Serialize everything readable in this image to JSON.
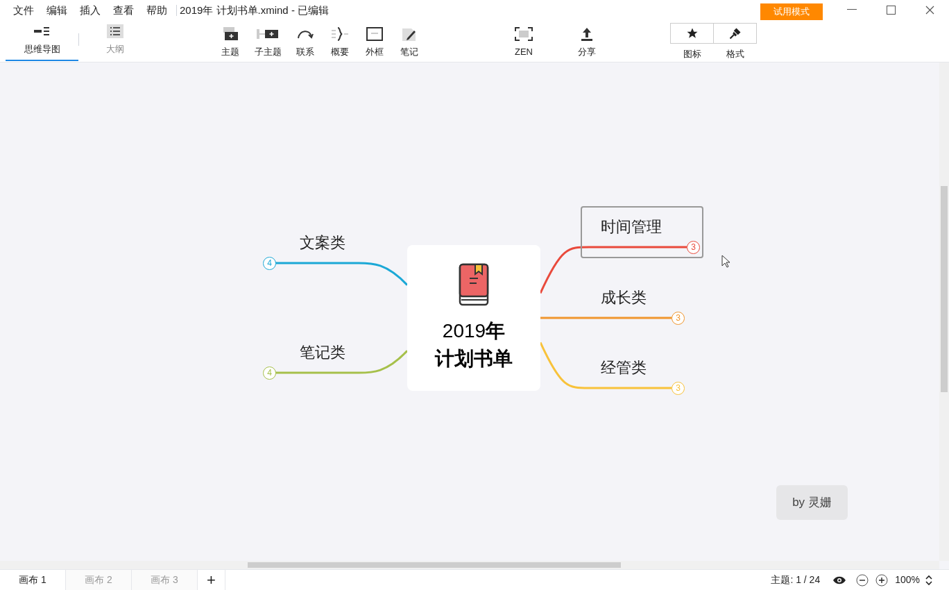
{
  "menu": [
    "文件",
    "编辑",
    "插入",
    "查看",
    "帮助"
  ],
  "window": {
    "title": "2019年 计划书单.xmind - 已编辑",
    "trial_button": "试用模式"
  },
  "view_tabs": [
    {
      "label": "思维导图",
      "selected": true
    },
    {
      "label": "大纲",
      "selected": false
    }
  ],
  "insert_tools": [
    "主题",
    "子主题",
    "联系",
    "概要",
    "外框",
    "笔记"
  ],
  "extra_tools": [
    "ZEN",
    "分享"
  ],
  "panel_tools": [
    "图标",
    "格式"
  ],
  "central_topic": {
    "title_lines": [
      "2019**年**",
      "计划书单"
    ]
  },
  "right_branches": [
    {
      "label": "时间管理",
      "count": "3",
      "color": "#e94a3c",
      "selected": true
    },
    {
      "label": "成长类",
      "count": "3",
      "color": "#f0962e",
      "selected": false
    },
    {
      "label": "经管类",
      "count": "3",
      "color": "#f8c23a",
      "selected": false
    }
  ],
  "left_branches": [
    {
      "label": "文案类",
      "count": "4",
      "color": "#1ba8d6",
      "selected": false
    },
    {
      "label": "笔记类",
      "count": "4",
      "color": "#a6c04a",
      "selected": false
    }
  ],
  "signature": "by 灵姗",
  "sheets": [
    {
      "label": "画布 1",
      "selected": true
    },
    {
      "label": "画布 2",
      "selected": false
    },
    {
      "label": "画布 3",
      "selected": false
    }
  ],
  "add_sheet": "+",
  "status": {
    "topic_count": "主题: 1 / 24",
    "zoom": "100%"
  }
}
